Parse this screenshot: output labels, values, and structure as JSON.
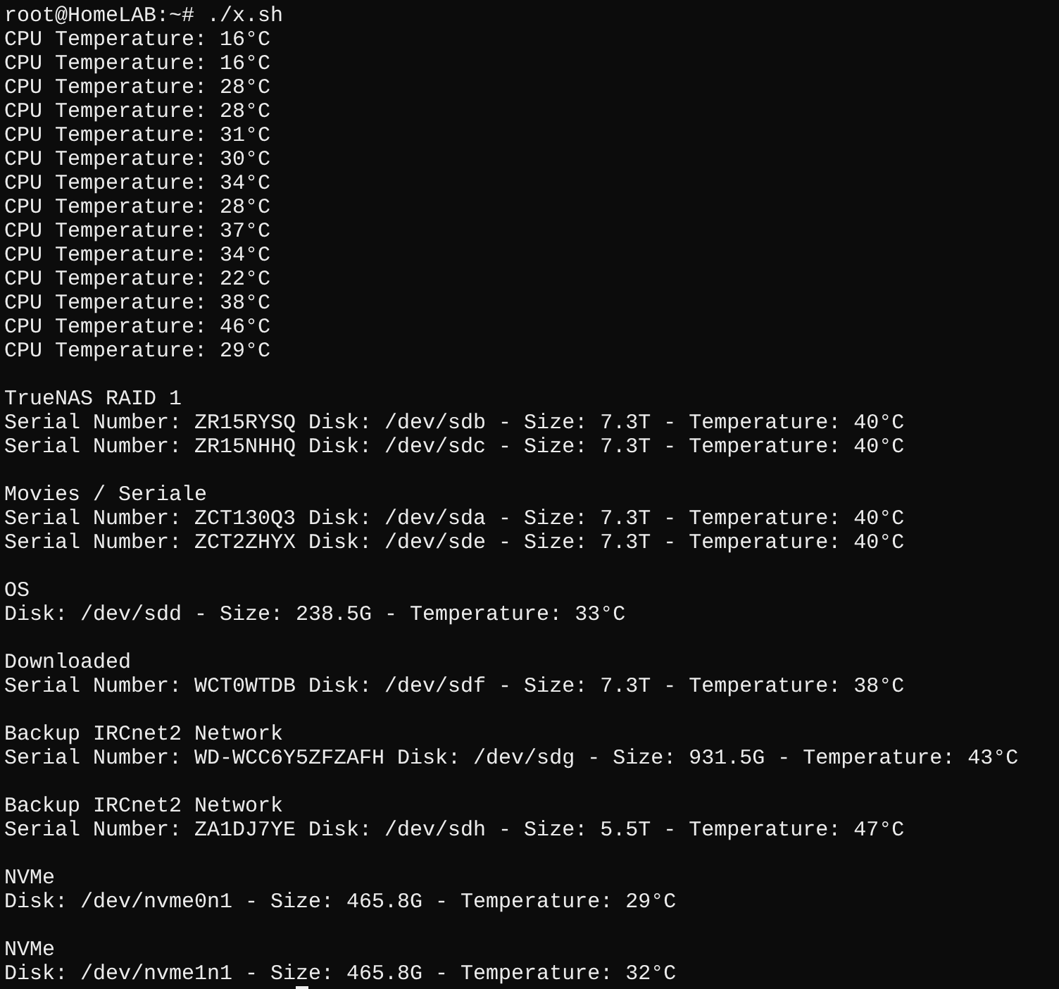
{
  "prompt": "root@HomeLAB:~# ./x.sh",
  "cpu_lines": [
    "CPU Temperature: 16°C",
    "CPU Temperature: 16°C",
    "CPU Temperature: 28°C",
    "CPU Temperature: 28°C",
    "CPU Temperature: 31°C",
    "CPU Temperature: 30°C",
    "CPU Temperature: 34°C",
    "CPU Temperature: 28°C",
    "CPU Temperature: 37°C",
    "CPU Temperature: 34°C",
    "CPU Temperature: 22°C",
    "CPU Temperature: 38°C",
    "CPU Temperature: 46°C",
    "CPU Temperature: 29°C"
  ],
  "groups": [
    {
      "title": "TrueNAS RAID 1",
      "lines": [
        "Serial Number: ZR15RYSQ Disk: /dev/sdb - Size: 7.3T - Temperature: 40°C",
        "Serial Number: ZR15NHHQ Disk: /dev/sdc - Size: 7.3T - Temperature: 40°C"
      ]
    },
    {
      "title": "Movies / Seriale",
      "lines": [
        "Serial Number: ZCT130Q3 Disk: /dev/sda - Size: 7.3T - Temperature: 40°C",
        "Serial Number: ZCT2ZHYX Disk: /dev/sde - Size: 7.3T - Temperature: 40°C"
      ]
    },
    {
      "title": "OS",
      "lines": [
        "Disk: /dev/sdd - Size: 238.5G - Temperature: 33°C"
      ]
    },
    {
      "title": "Downloaded",
      "lines": [
        "Serial Number: WCT0WTDB Disk: /dev/sdf - Size: 7.3T - Temperature: 38°C"
      ]
    },
    {
      "title": "Backup IRCnet2 Network",
      "lines": [
        "Serial Number: WD-WCC6Y5ZFZAFH Disk: /dev/sdg - Size: 931.5G - Temperature: 43°C"
      ]
    },
    {
      "title": "Backup IRCnet2 Network",
      "lines": [
        "Serial Number: ZA1DJ7YE Disk: /dev/sdh - Size: 5.5T - Temperature: 47°C"
      ]
    },
    {
      "title": "NVMe",
      "lines": [
        "Disk: /dev/nvme0n1 - Size: 465.8G - Temperature: 29°C"
      ]
    },
    {
      "title": "NVMe",
      "lines": [
        "Disk: /dev/nvme1n1 - Size: 465.8G - Temperature: 32°C"
      ]
    }
  ]
}
